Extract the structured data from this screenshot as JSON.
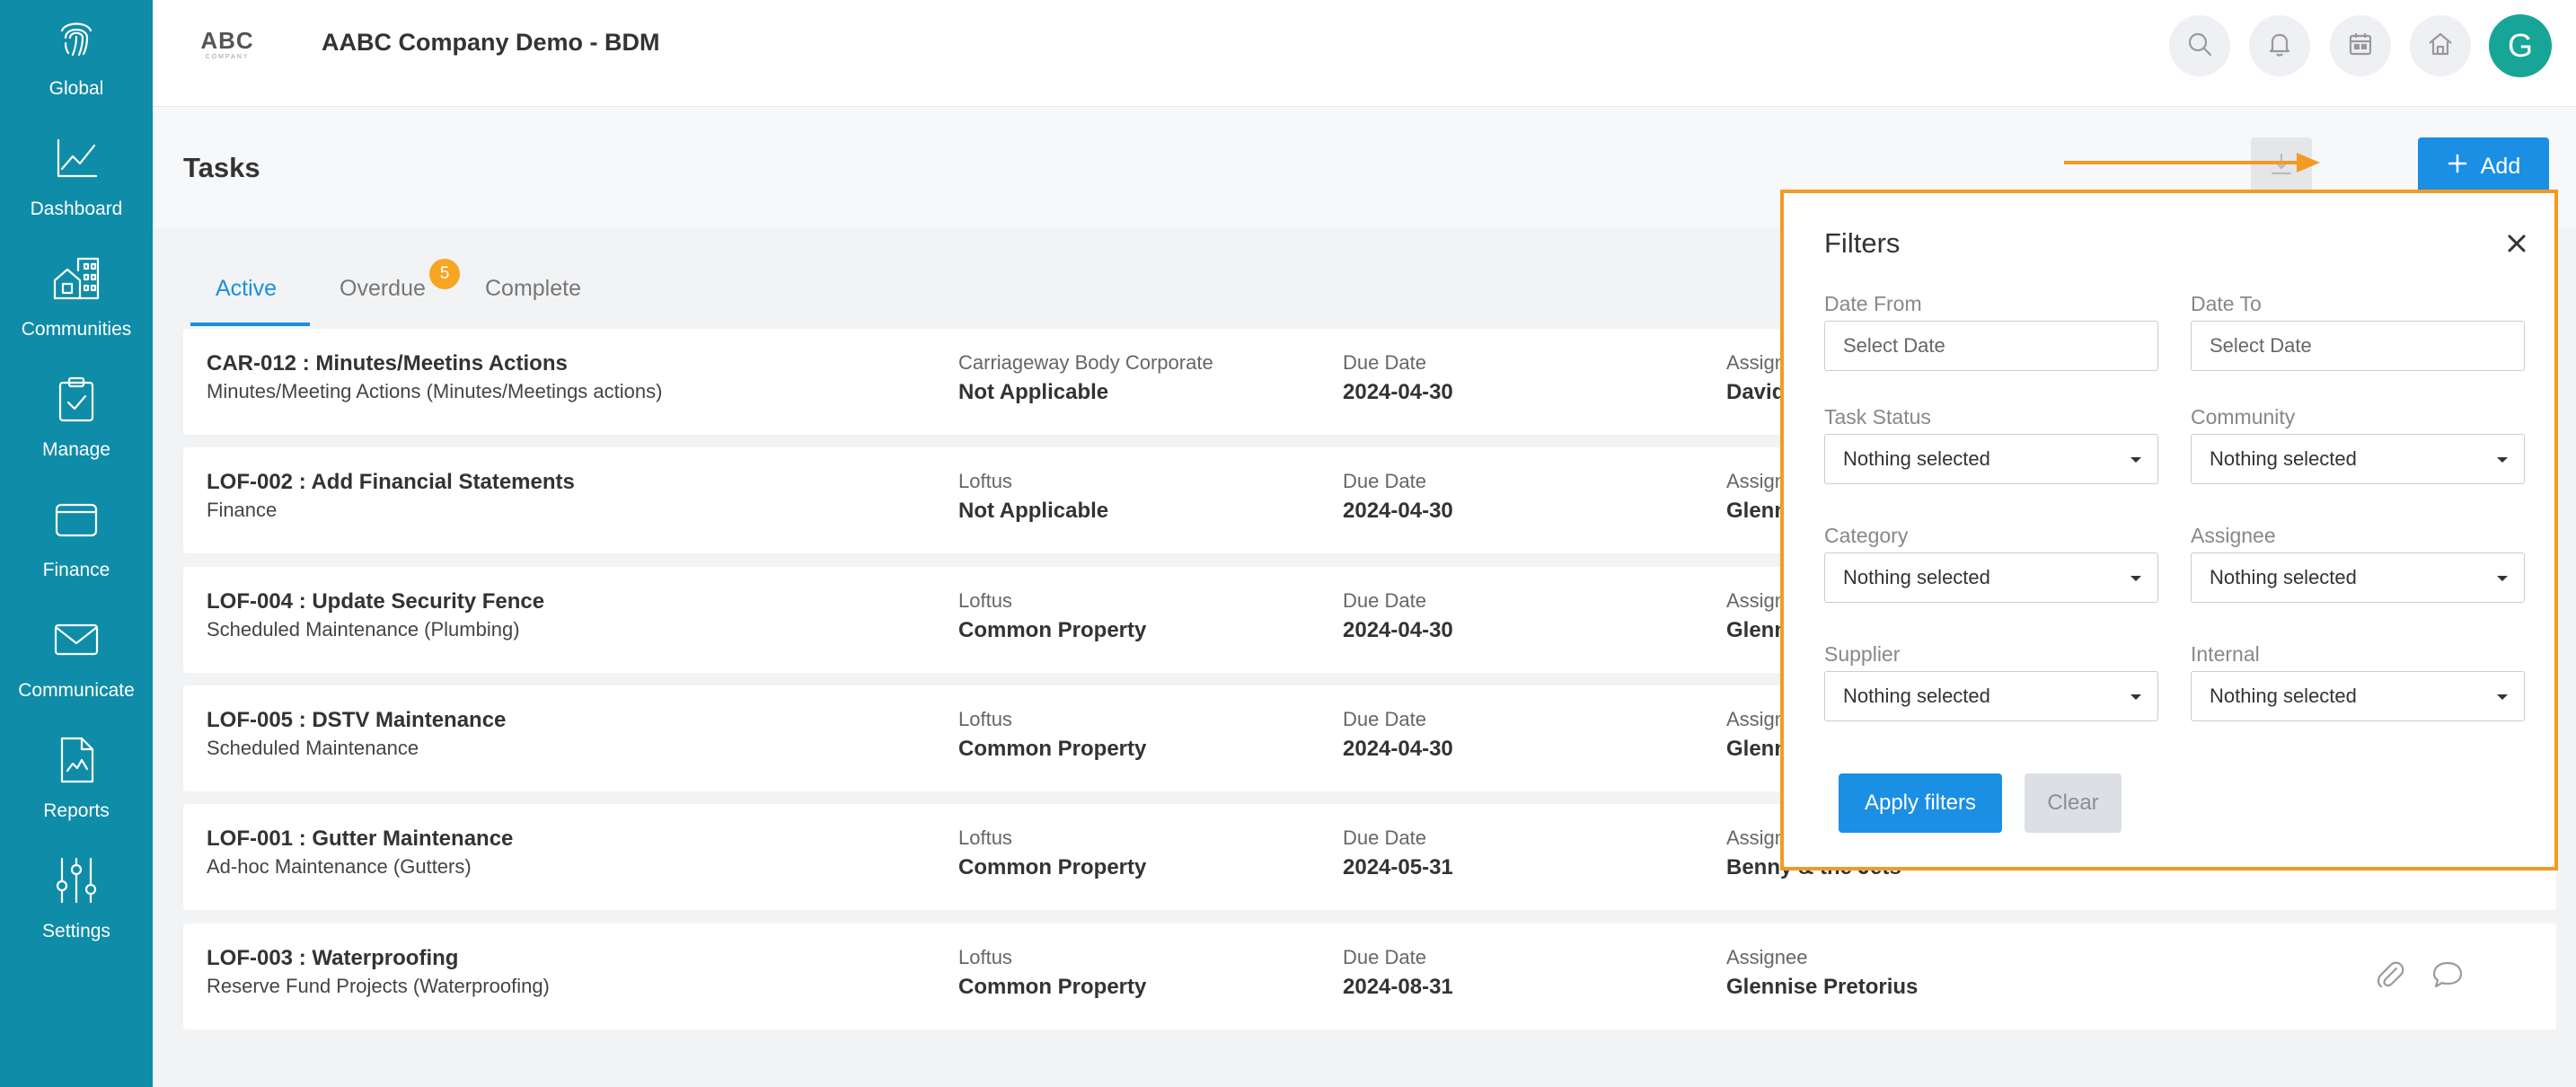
{
  "sidebar": {
    "items": [
      {
        "label": "Global",
        "icon": "fingerprint-icon"
      },
      {
        "label": "Dashboard",
        "icon": "line-chart-icon"
      },
      {
        "label": "Communities",
        "icon": "buildings-icon"
      },
      {
        "label": "Manage",
        "icon": "clipboard-check-icon"
      },
      {
        "label": "Finance",
        "icon": "wallet-icon"
      },
      {
        "label": "Communicate",
        "icon": "envelope-icon"
      },
      {
        "label": "Reports",
        "icon": "report-document-icon"
      },
      {
        "label": "Settings",
        "icon": "sliders-icon"
      }
    ]
  },
  "header": {
    "logo_text": "ABC",
    "logo_subtext": "COMPANY",
    "company": "AABC Company Demo - BDM",
    "avatar_initial": "G",
    "icons": [
      "search-icon",
      "bell-icon",
      "calendar-icon",
      "home-icon"
    ]
  },
  "page": {
    "title": "Tasks",
    "add_label": "Add"
  },
  "tabs": {
    "active": "Active",
    "overdue": "Overdue",
    "overdue_badge": "5",
    "complete": "Complete"
  },
  "tasks": [
    {
      "title": "CAR-012 : Minutes/Meetins Actions",
      "subtitle": "Minutes/Meeting Actions (Minutes/Meetings actions)",
      "community": "Carriageway Body Corporate",
      "property": "Not Applicable",
      "due_label": "Due Date",
      "due": "2024-04-30",
      "assignee_label": "Assignee",
      "assignee": "David"
    },
    {
      "title": "LOF-002 : Add Financial Statements",
      "subtitle": "Finance",
      "community": "Loftus",
      "property": "Not Applicable",
      "due_label": "Due Date",
      "due": "2024-04-30",
      "assignee_label": "Assignee",
      "assignee": "Glenni"
    },
    {
      "title": "LOF-004 : Update Security Fence",
      "subtitle": "Scheduled Maintenance (Plumbing)",
      "community": "Loftus",
      "property": "Common Property",
      "due_label": "Due Date",
      "due": "2024-04-30",
      "assignee_label": "Assignee",
      "assignee": "Glenni"
    },
    {
      "title": "LOF-005 : DSTV Maintenance",
      "subtitle": "Scheduled Maintenance",
      "community": "Loftus",
      "property": "Common Property",
      "due_label": "Due Date",
      "due": "2024-04-30",
      "assignee_label": "Assignee",
      "assignee": "Glenni"
    },
    {
      "title": "LOF-001 : Gutter Maintenance",
      "subtitle": "Ad-hoc Maintenance (Gutters)",
      "community": "Loftus",
      "property": "Common Property",
      "due_label": "Due Date",
      "due": "2024-05-31",
      "assignee_label": "Assignee",
      "assignee": "Benny & the Jets"
    },
    {
      "title": "LOF-003 : Waterproofing",
      "subtitle": "Reserve Fund Projects (Waterproofing)",
      "community": "Loftus",
      "property": "Common Property",
      "due_label": "Due Date",
      "due": "2024-08-31",
      "assignee_label": "Assignee",
      "assignee": "Glennise Pretorius"
    }
  ],
  "filters": {
    "title": "Filters",
    "date_from_label": "Date From",
    "date_from_placeholder": "Select Date",
    "date_to_label": "Date To",
    "date_to_placeholder": "Select Date",
    "task_status_label": "Task Status",
    "task_status_value": "Nothing selected",
    "community_label": "Community",
    "community_value": "Nothing selected",
    "category_label": "Category",
    "category_value": "Nothing selected",
    "assignee_label": "Assignee",
    "assignee_value": "Nothing selected",
    "supplier_label": "Supplier",
    "supplier_value": "Nothing selected",
    "internal_label": "Internal",
    "internal_value": "Nothing selected",
    "apply_label": "Apply filters",
    "clear_label": "Clear"
  },
  "colors": {
    "sidebar": "#0f8ca8",
    "accent": "#1a8fe3",
    "highlight": "#f39a25",
    "badge": "#f6a623",
    "avatar": "#17a597"
  }
}
